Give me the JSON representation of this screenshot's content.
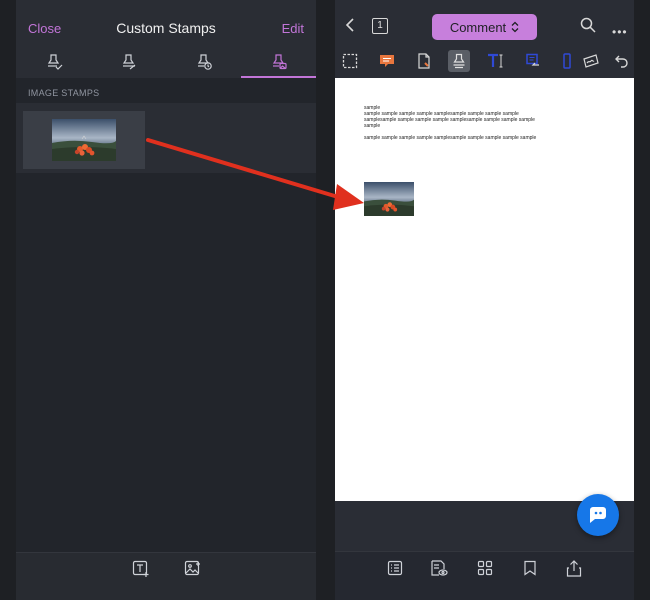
{
  "left_panel": {
    "close_label": "Close",
    "title": "Custom Stamps",
    "edit_label": "Edit",
    "tabs": [
      {
        "icon": "stamp-check-icon"
      },
      {
        "icon": "stamp-sign-icon"
      },
      {
        "icon": "stamp-time-icon"
      },
      {
        "icon": "stamp-image-icon",
        "active": true
      }
    ],
    "section_label": "IMAGE STAMPS",
    "bottom_icons": [
      "add-text-stamp-icon",
      "add-image-stamp-icon"
    ]
  },
  "right_panel": {
    "page_number": "1",
    "mode_label": "Comment",
    "toolbar_icons": [
      "select-rect-icon",
      "note-icon",
      "file-attach-icon",
      "stamp-icon",
      "text-box-icon",
      "callout-icon",
      "shape-icon",
      "signature-icon",
      "undo-icon"
    ],
    "document": {
      "lines": [
        "sample",
        "sample sample sample sample samplesample sample sample sample",
        "samplesample sample sample sample samplesample sample sample sample",
        "sample",
        "sample sample sample sample samplesample sample sample sample sample"
      ]
    },
    "bottom_icons": [
      "outline-icon",
      "reader-mode-icon",
      "thumbnails-icon",
      "bookmark-icon",
      "share-icon"
    ]
  },
  "colors": {
    "accent": "#c275d8",
    "comment_button": "#c77fdc",
    "fab": "#1677e8",
    "arrow": "#e0301e"
  }
}
